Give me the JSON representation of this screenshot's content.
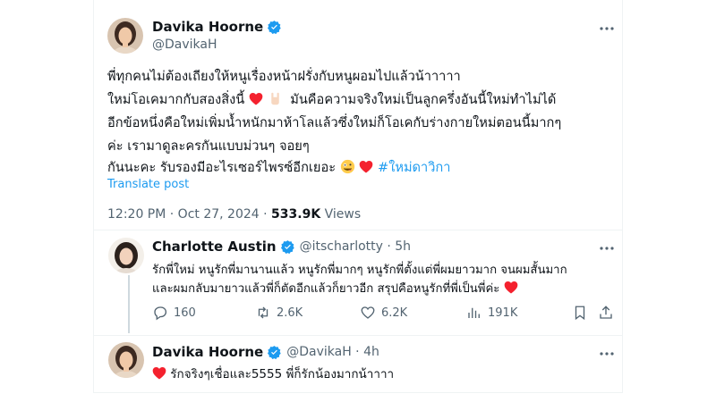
{
  "main_post": {
    "author_name": "Davika Hoorne",
    "author_handle": "@DavikaH",
    "lines": [
      "พี่ทุกคนไม่ต้องเถียงให้หนูเรื่องหน้าฝรั่งกับหนูผอมไปแล้วน้าาาาา",
      "ใหม่โอเคมากกับสองสิ่งนี้",
      "มันคือความจริงใหม่เป็นลูกครึ่งอันนี้ใหม่ทำไม่ได้",
      "อีกข้อหนึ่งคือใหม่เพิ่มน้ำหนักมาห้าโลแล้วซึ่งใหม่ก็โอเคกับร่างกายใหม่ตอนนี้มากๆ",
      "ค่ะ เรามาดูละครกันแบบม่วนๆ จอยๆ",
      "กันนะคะ รับรองมีอะไรเซอร์ไพรซ์อีกเยอะ"
    ],
    "hashtag": "#ใหม่ดาวิกา",
    "translate_label": "Translate post",
    "time": "12:20 PM · Oct 27, 2024 · ",
    "views_count": "533.9K",
    "views_label": " Views"
  },
  "reply1": {
    "author_name": "Charlotte Austin",
    "author_handle": "@itscharlotty · 5h",
    "lines": [
      "รักพี่ใหม่ หนูรักพี่มานานแล้ว หนูรักพี่มากๆ หนูรักพี่ตั้งแต่พี่ผมยาวมาก จนผมสั้นมาก",
      "และผมกลับมายาวแล้วพี่ก็ตัดอีกแล้วก็ยาวอีก สรุปคือหนูรักที่พี่เป็นพี่ค่ะ"
    ],
    "actions": {
      "replies": "160",
      "reposts": "2.6K",
      "likes": "6.2K",
      "views": "191K"
    }
  },
  "reply2": {
    "author_name": "Davika Hoorne",
    "author_handle": "@DavikaH · 4h",
    "text": "รักจริงๆเชื่อและ5555 พี่ก็รักน้องมากน้าาาา"
  },
  "colors": {
    "accent": "#1d9bf0",
    "heart": "#f4212e",
    "secondary_text": "#536471"
  }
}
